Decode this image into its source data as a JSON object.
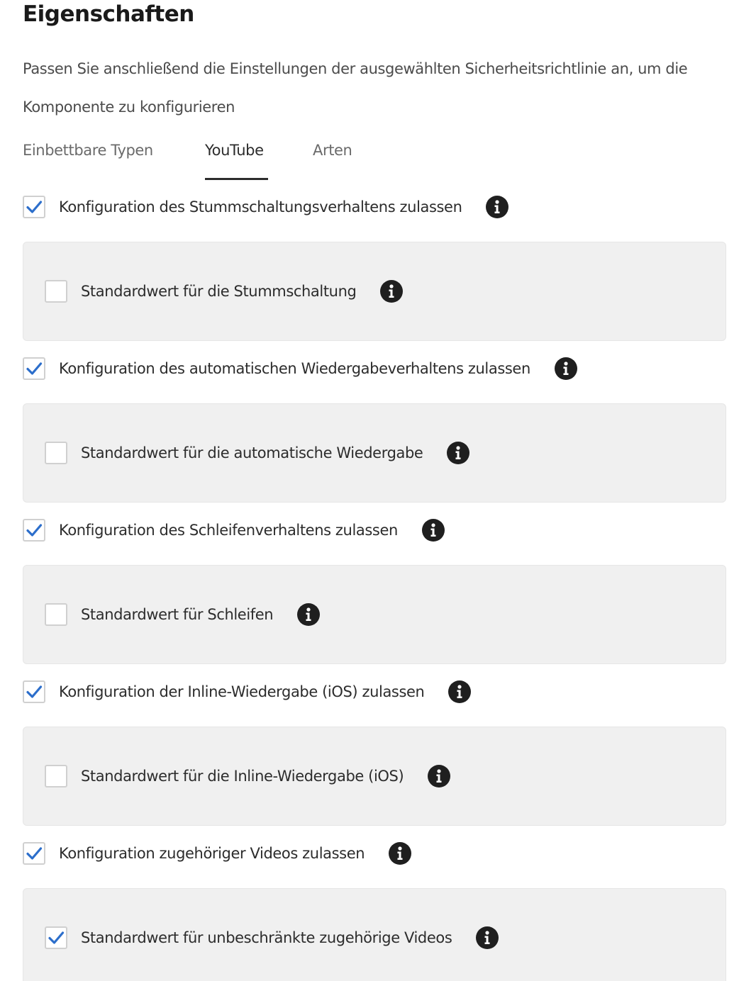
{
  "page": {
    "title": "Eigenschaften",
    "description": "Passen Sie anschließend die Einstellungen der ausgewählten Sicherheitsrichtlinie an, um die Komponente zu konfigurieren"
  },
  "tabs": [
    {
      "label": "Einbettbare Typen",
      "active": false
    },
    {
      "label": "YouTube",
      "active": true
    },
    {
      "label": "Arten",
      "active": false
    }
  ],
  "options": [
    {
      "label": "Konfiguration des Stummschaltungsverhaltens zulassen",
      "checked": true,
      "sub": {
        "label": "Standardwert für die Stummschaltung",
        "checked": false
      }
    },
    {
      "label": "Konfiguration des automatischen Wiedergabeverhaltens zulassen",
      "checked": true,
      "sub": {
        "label": "Standardwert für die automatische Wiedergabe",
        "checked": false
      }
    },
    {
      "label": "Konfiguration des Schleifenverhaltens zulassen",
      "checked": true,
      "sub": {
        "label": "Standardwert für Schleifen",
        "checked": false
      }
    },
    {
      "label": "Konfiguration der Inline-Wiedergabe (iOS) zulassen",
      "checked": true,
      "sub": {
        "label": "Standardwert für die Inline-Wiedergabe (iOS)",
        "checked": false
      }
    },
    {
      "label": "Konfiguration zugehöriger Videos zulassen",
      "checked": true,
      "sub": {
        "label": "Standardwert für unbeschränkte zugehörige Videos",
        "checked": true
      }
    }
  ],
  "icons": {
    "checkmark": "checkmark-icon",
    "info": "info-icon"
  },
  "colors": {
    "accent": "#2c6ecb",
    "panel_bg": "#f0f0f0",
    "info_bg": "#1f1f1f"
  }
}
